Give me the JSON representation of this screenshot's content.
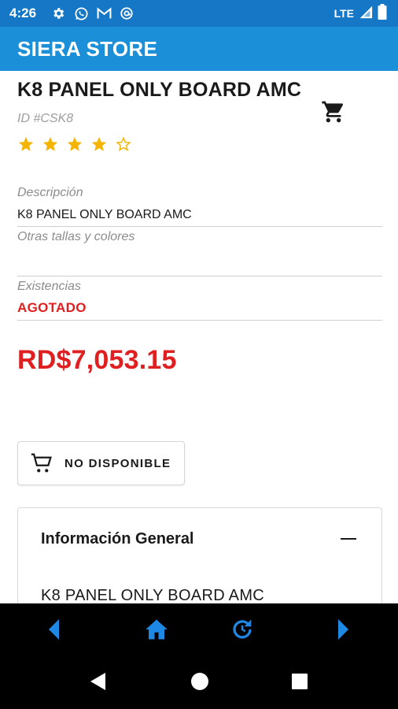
{
  "status_bar": {
    "time": "4:26",
    "network": "LTE",
    "icons": [
      "settings-icon",
      "whatsapp-icon",
      "gmail-icon",
      "at-sign-icon",
      "signal-icon",
      "battery-icon"
    ]
  },
  "app_bar": {
    "title": "SIERA STORE",
    "color": "#1b8fd8"
  },
  "product": {
    "title": "K8 PANEL ONLY BOARD AMC",
    "id": "ID #CSK8",
    "rating": 4,
    "rating_max": 5,
    "description_label": "Descripción",
    "description_value": "K8 PANEL ONLY BOARD AMC",
    "variants_label": "Otras tallas y colores",
    "stock_label": "Existencias",
    "stock_value": "AGOTADO",
    "price": "RD$7,053.15"
  },
  "actions": {
    "unavailable_label": "NO DISPONIBLE"
  },
  "info_card": {
    "title": "Información General",
    "body": "K8 PANEL ONLY BOARD AMC"
  },
  "bottom_nav": {
    "icons": [
      "back-arrow-icon",
      "home-icon",
      "refresh-icon",
      "forward-arrow-icon"
    ],
    "accent": "#1e88e5"
  },
  "system_nav": {
    "icons": [
      "system-back-icon",
      "system-home-icon",
      "system-recents-icon"
    ]
  },
  "colors": {
    "status_bar": "#1677c6",
    "price": "#e02020",
    "star": "#f4b400"
  }
}
